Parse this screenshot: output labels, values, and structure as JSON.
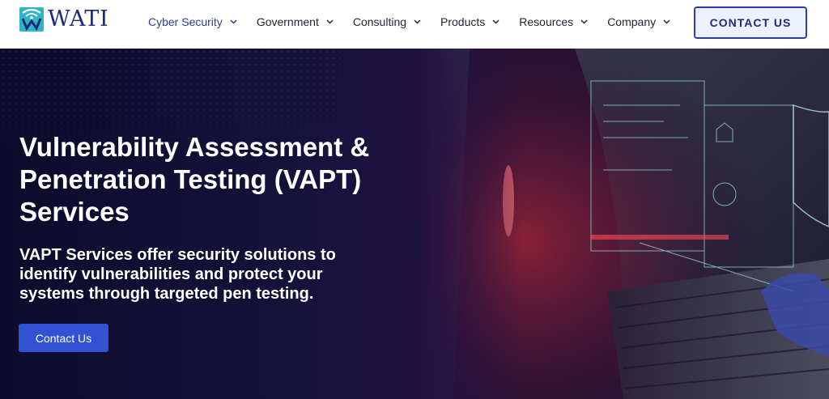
{
  "brand": {
    "name": "WATI",
    "logo_icon": "wifi-w-logo-icon"
  },
  "nav": {
    "items": [
      {
        "label": "Cyber Security",
        "icon": "chevron-down-icon",
        "active": true
      },
      {
        "label": "Government",
        "icon": "chevron-down-icon"
      },
      {
        "label": "Consulting",
        "icon": "chevron-down-icon"
      },
      {
        "label": "Products",
        "icon": "chevron-down-icon"
      },
      {
        "label": "Resources",
        "icon": "chevron-down-icon"
      },
      {
        "label": "Company",
        "icon": "chevron-down-icon"
      }
    ],
    "cta_label": "CONTACT US"
  },
  "hero": {
    "title_line1": "Vulnerability Assessment &",
    "title_line2": "Penetration Testing (VAPT)",
    "title_line3": "Services",
    "sub_line1": "VAPT Services offer security solutions to",
    "sub_line2": "identify vulnerabilities and protect your",
    "sub_line3": "systems through targeted pen testing.",
    "cta_label": "Contact Us"
  },
  "colors": {
    "brand_navy": "#1d2a78",
    "nav_active": "#2c3c96",
    "hero_bg": "#0f0c2e",
    "cta_blue": "#3252d6",
    "logo_cyan": "#2fb5c6"
  }
}
